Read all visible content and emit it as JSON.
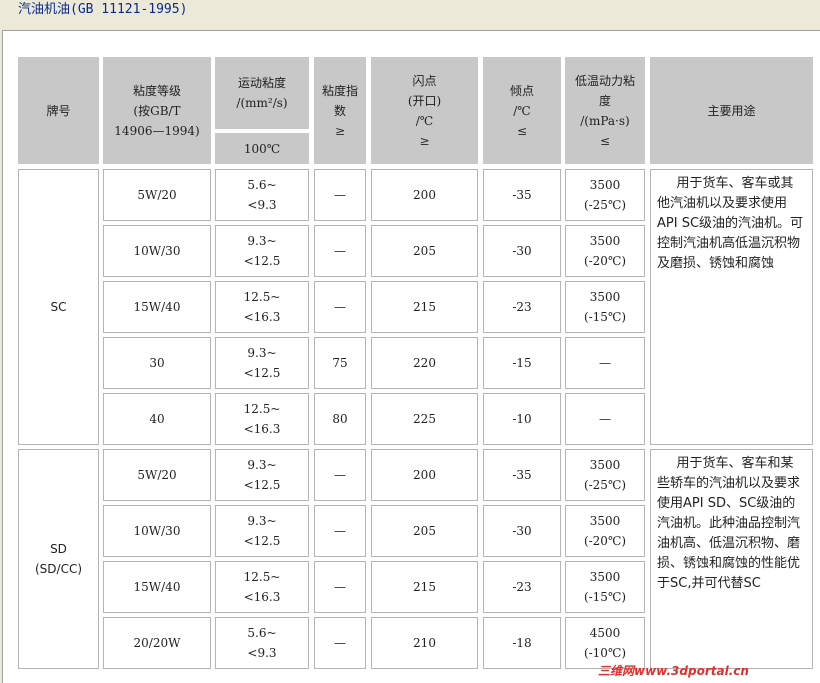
{
  "window_title": "汽油机油(GB 11121-1995)",
  "headers": {
    "grade": "牌号",
    "viscosity_grade": [
      "粘度等级",
      "(按GB/T",
      "14906—1994)"
    ],
    "kinematic_viscosity": [
      "运动粘度",
      "/(mm²/s)"
    ],
    "temp_100": "100℃",
    "viscosity_index": [
      "粘度指",
      "数",
      "≥"
    ],
    "flash_point": [
      "闪点",
      "(开口)",
      "/℃",
      "≥"
    ],
    "pour_point": [
      "倾点",
      "/℃",
      "≤"
    ],
    "low_temp_viscosity": [
      "低温动力粘",
      "度",
      "/(mPa·s)",
      "≤"
    ],
    "usage": "主要用途"
  },
  "groups": [
    {
      "grade_lines": [
        "SC"
      ],
      "usage": "用于货车、客车或其他汽油机以及要求使用API SC级油的汽油机。可控制汽油机高低温沉积物及磨损、锈蚀和腐蚀",
      "rows": [
        {
          "viscosity_grade": "5W/20",
          "kv": [
            "5.6~",
            "<9.3"
          ],
          "vi": "—",
          "flash": "200",
          "pour": "-35",
          "ltv": [
            "3500",
            "(-25℃)"
          ]
        },
        {
          "viscosity_grade": "10W/30",
          "kv": [
            "9.3~",
            "<12.5"
          ],
          "vi": "—",
          "flash": "205",
          "pour": "-30",
          "ltv": [
            "3500",
            "(-20℃)"
          ]
        },
        {
          "viscosity_grade": "15W/40",
          "kv": [
            "12.5~",
            "<16.3"
          ],
          "vi": "—",
          "flash": "215",
          "pour": "-23",
          "ltv": [
            "3500",
            "(-15℃)"
          ]
        },
        {
          "viscosity_grade": "30",
          "kv": [
            "9.3~",
            "<12.5"
          ],
          "vi": "75",
          "flash": "220",
          "pour": "-15",
          "ltv": [
            "—"
          ]
        },
        {
          "viscosity_grade": "40",
          "kv": [
            "12.5~",
            "<16.3"
          ],
          "vi": "80",
          "flash": "225",
          "pour": "-10",
          "ltv": [
            "—"
          ]
        }
      ]
    },
    {
      "grade_lines": [
        "SD",
        "(SD/CC)"
      ],
      "usage": "用于货车、客车和某些轿车的汽油机以及要求使用API SD、SC级油的汽油机。此种油品控制汽油机高、低温沉积物、磨损、锈蚀和腐蚀的性能优于SC,并可代替SC",
      "rows": [
        {
          "viscosity_grade": "5W/20",
          "kv": [
            "9.3~",
            "<12.5"
          ],
          "vi": "—",
          "flash": "200",
          "pour": "-35",
          "ltv": [
            "3500",
            "(-25℃)"
          ]
        },
        {
          "viscosity_grade": "10W/30",
          "kv": [
            "9.3~",
            "<12.5"
          ],
          "vi": "—",
          "flash": "205",
          "pour": "-30",
          "ltv": [
            "3500",
            "(-20℃)"
          ]
        },
        {
          "viscosity_grade": "15W/40",
          "kv": [
            "12.5~",
            "<16.3"
          ],
          "vi": "—",
          "flash": "215",
          "pour": "-23",
          "ltv": [
            "3500",
            "(-15℃)"
          ]
        },
        {
          "viscosity_grade": "20/20W",
          "kv": [
            "5.6~",
            "<9.3"
          ],
          "vi": "—",
          "flash": "210",
          "pour": "-18",
          "ltv": [
            "4500",
            "(-10℃)"
          ]
        }
      ]
    }
  ],
  "watermark": "三维网www.3dportal.cn"
}
